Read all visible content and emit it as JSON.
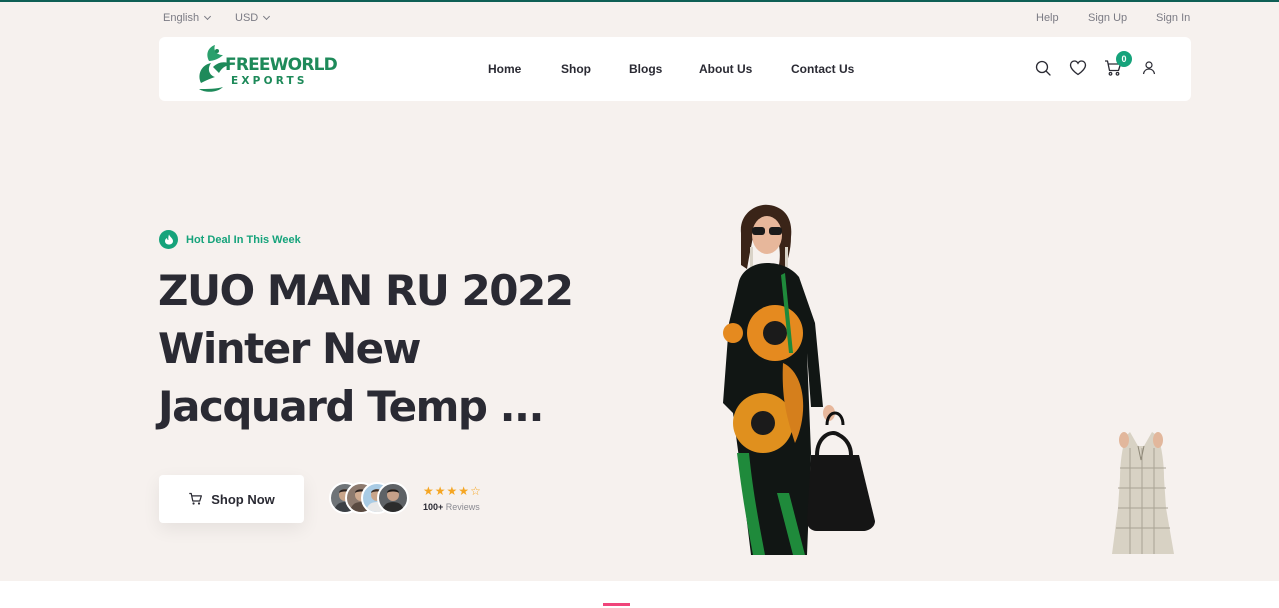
{
  "topbar": {
    "language": "English",
    "currency": "USD",
    "help": "Help",
    "sign_up": "Sign Up",
    "sign_in": "Sign In"
  },
  "header": {
    "logo": {
      "line1": "FREEWORLD",
      "line2": "EXPORTS"
    },
    "nav": [
      "Home",
      "Shop",
      "Blogs",
      "About Us",
      "Contact Us"
    ],
    "icons": [
      "search-icon",
      "heart-icon",
      "cart-icon",
      "user-icon"
    ],
    "cart_count": "0"
  },
  "hero": {
    "deal_label": "Hot Deal In This Week",
    "title_lines": [
      "ZUO MAN RU 2022",
      "Winter New",
      "Jacquard Temp ..."
    ],
    "shop_button": "Shop Now",
    "rating": 4,
    "rating_max": 5,
    "reviews_count": "100+",
    "reviews_label": "Reviews"
  },
  "colors": {
    "accent": "#16a37b",
    "background": "#f6f1ee",
    "star": "#f5a623",
    "bottom_marker": "#f0447a"
  }
}
